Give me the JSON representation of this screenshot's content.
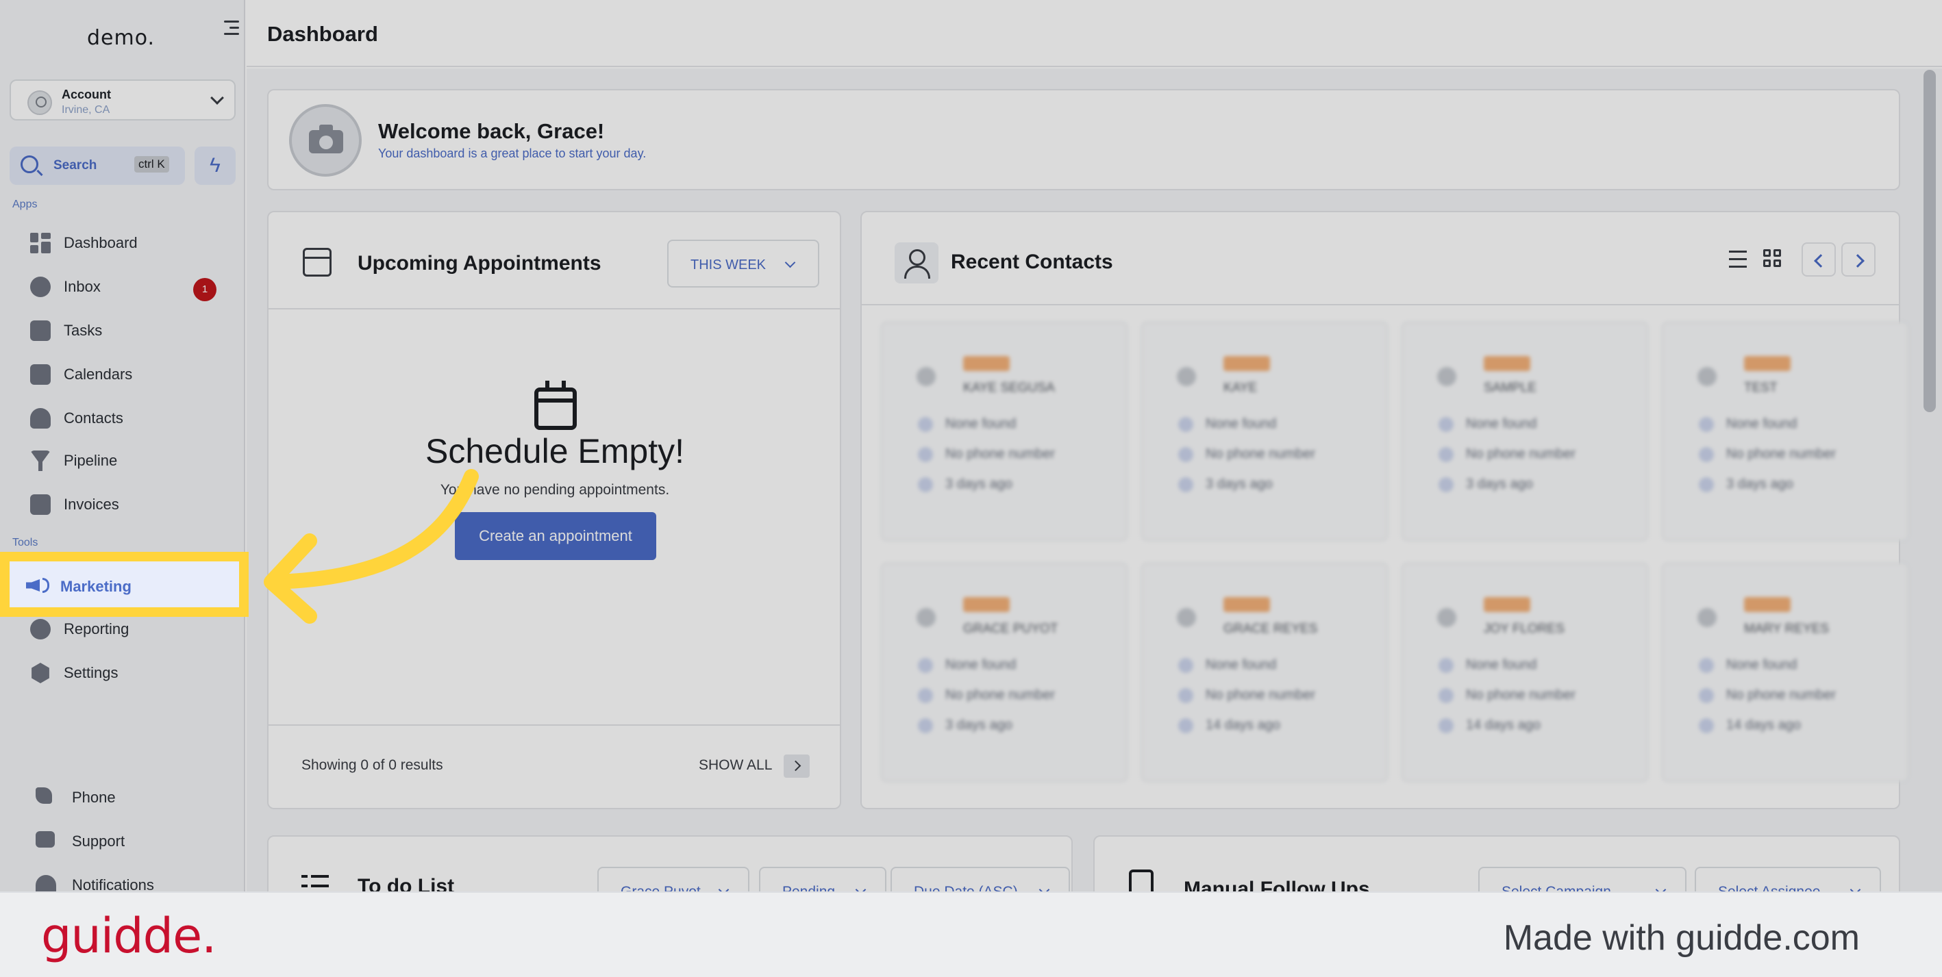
{
  "app": {
    "logo": "demo."
  },
  "account": {
    "name": "Account",
    "location": "Irvine, CA"
  },
  "search": {
    "label": "Search",
    "shortcut": "ctrl K"
  },
  "sidebar": {
    "apps_label": "Apps",
    "tools_label": "Tools",
    "items": [
      {
        "label": "Dashboard"
      },
      {
        "label": "Inbox",
        "badge": "1"
      },
      {
        "label": "Tasks"
      },
      {
        "label": "Calendars"
      },
      {
        "label": "Contacts"
      },
      {
        "label": "Pipeline"
      },
      {
        "label": "Invoices"
      }
    ],
    "tools": [
      {
        "label": "Marketing"
      },
      {
        "label": "Reporting"
      },
      {
        "label": "Settings"
      }
    ],
    "bottom": [
      {
        "label": "Phone"
      },
      {
        "label": "Support"
      },
      {
        "label": "Notifications"
      }
    ]
  },
  "header": {
    "title": "Dashboard"
  },
  "welcome": {
    "title": "Welcome back, Grace!",
    "subtitle": "Your dashboard is a great place to start your day."
  },
  "appointments": {
    "title": "Upcoming Appointments",
    "range": "THIS WEEK",
    "empty_title": "Schedule Empty!",
    "empty_subtitle": "You have no pending appointments.",
    "create_label": "Create an appointment",
    "results": "Showing 0 of 0 results",
    "show_all": "SHOW ALL"
  },
  "contacts": {
    "title": "Recent Contacts",
    "cards": [
      {
        "name": "KAYE SEGUSA",
        "email": "None found",
        "phone": "No phone number",
        "time": "3 days ago"
      },
      {
        "name": "KAYE",
        "email": "None found",
        "phone": "No phone number",
        "time": "3 days ago"
      },
      {
        "name": "SAMPLE",
        "email": "None found",
        "phone": "No phone number",
        "time": "3 days ago"
      },
      {
        "name": "TEST",
        "email": "None found",
        "phone": "No phone number",
        "time": "3 days ago"
      },
      {
        "name": "GRACE PUYOT",
        "email": "None found",
        "phone": "No phone number",
        "time": "3 days ago"
      },
      {
        "name": "GRACE REYES",
        "email": "None found",
        "phone": "No phone number",
        "time": "14 days ago"
      },
      {
        "name": "JOY FLORES",
        "email": "None found",
        "phone": "No phone number",
        "time": "14 days ago"
      },
      {
        "name": "MARY REYES",
        "email": "None found",
        "phone": "No phone number",
        "time": "14 days ago"
      }
    ]
  },
  "todo": {
    "title": "To do List",
    "filters": [
      "Grace Puyot",
      "Pending",
      "Due Date (ASC)"
    ]
  },
  "followups": {
    "title": "Manual Follow Ups",
    "filters": [
      "Select Campaign",
      "Select Assignee"
    ]
  },
  "footer": {
    "logo": "guidde.",
    "text": "Made with guidde.com"
  },
  "colors": {
    "accent": "#4b6cc7",
    "highlight": "#ffd43b",
    "badge": "#c0171b",
    "brand": "#c8102e"
  }
}
